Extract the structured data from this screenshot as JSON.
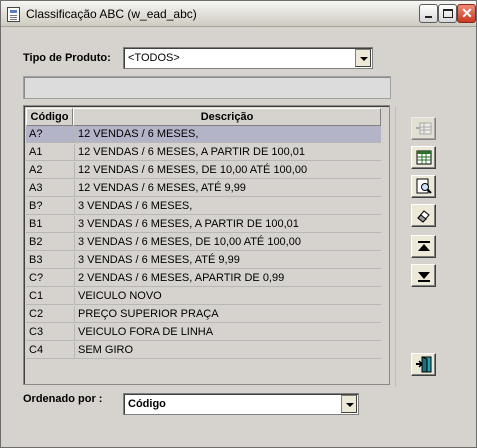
{
  "window": {
    "title": "Classificação ABC (w_ead_abc)"
  },
  "tipo_produto": {
    "label": "Tipo de Produto:",
    "value": "<TODOS>"
  },
  "grid": {
    "columns": [
      "Código",
      "Descrição"
    ],
    "rows": [
      {
        "codigo": "A?",
        "descricao": "12 VENDAS / 6 MESES,"
      },
      {
        "codigo": "A1",
        "descricao": "12 VENDAS / 6 MESES, A PARTIR DE 100,01"
      },
      {
        "codigo": "A2",
        "descricao": "12 VENDAS / 6 MESES, DE 10,00 ATÉ 100,00"
      },
      {
        "codigo": "A3",
        "descricao": "12 VENDAS / 6 MESES,  ATÉ 9,99"
      },
      {
        "codigo": "B?",
        "descricao": "3 VENDAS / 6 MESES,"
      },
      {
        "codigo": "B1",
        "descricao": "3 VENDAS / 6 MESES, A PARTIR DE 100,01"
      },
      {
        "codigo": "B2",
        "descricao": "3 VENDAS / 6 MESES, DE 10,00 ATÉ 100,00"
      },
      {
        "codigo": "B3",
        "descricao": "3 VENDAS / 6 MESES,  ATÉ 9,99"
      },
      {
        "codigo": "C?",
        "descricao": "2 VENDAS / 6 MESES, APARTIR DE 0,99"
      },
      {
        "codigo": "C1",
        "descricao": "VEICULO NOVO"
      },
      {
        "codigo": "C2",
        "descricao": "PREÇO SUPERIOR PRAÇA"
      },
      {
        "codigo": "C3",
        "descricao": "VEICULO  FORA  DE LINHA"
      },
      {
        "codigo": "C4",
        "descricao": "SEM GIRO"
      }
    ]
  },
  "ordenado_por": {
    "label": "Ordenado por :",
    "value": "Código"
  },
  "toolbar_icons": [
    "insert-row-icon",
    "table-grid-icon",
    "print-preview-icon",
    "eraser-icon",
    "move-up-icon",
    "move-down-icon",
    "exit-door-icon"
  ]
}
